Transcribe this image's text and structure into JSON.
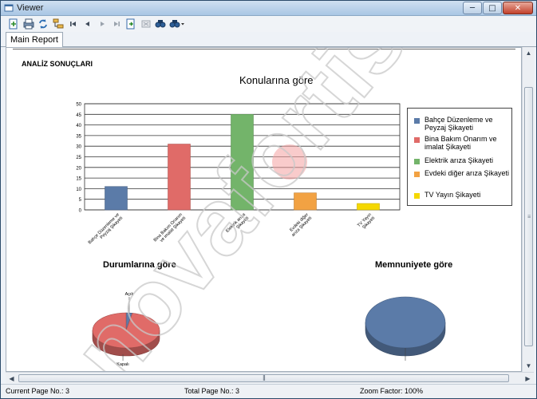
{
  "window": {
    "title": "Viewer",
    "minimize_glyph": "─",
    "maximize_glyph": "□",
    "close_glyph": "✕"
  },
  "toolbar": {
    "icons": [
      "export-icon",
      "print-icon",
      "refresh-icon",
      "tree-icon",
      "first-page-icon",
      "prev-page-icon",
      "next-page-icon",
      "last-page-icon",
      "goto-page-icon",
      "stop-icon",
      "find-icon",
      "zoom-icon"
    ]
  },
  "tabs": [
    {
      "label": "Main Report"
    }
  ],
  "report": {
    "heading": "ANALİZ SONUÇLARI",
    "bar_title": "Konularına göre",
    "pie1_title": "Durumlarına göre",
    "pie2_title": "Memnuniyete göre",
    "pie1_labels": [
      "Açık",
      "Kapalı"
    ],
    "legend": [
      {
        "label": "Bahçe Düzenleme ve Peyzaj Şikayeti",
        "color": "#5b7ba8"
      },
      {
        "label": "Bina Bakım Onarım ve imalat Şikayeti",
        "color": "#e06b68"
      },
      {
        "label": "Elektrik arıza Şikayeti",
        "color": "#73b46a"
      },
      {
        "label": "Evdeki diğer arıza Şikayeti",
        "color": "#f2a243"
      },
      {
        "label": "TV Yayın Şikayeti",
        "color": "#f5d800"
      }
    ]
  },
  "chart_data": [
    {
      "type": "bar",
      "title": "Konularına göre",
      "categories": [
        "Bahçe Düzenleme ve Peyzaj Şikayeti",
        "Bina Bakım Onarım ve imalat Şikayeti",
        "Elektrik arıza Şikayeti",
        "Evdeki diğer arıza Şikayeti",
        "TV Yayın Şikayeti"
      ],
      "values": [
        11,
        31,
        45,
        8,
        3
      ],
      "colors": [
        "#5b7ba8",
        "#e06b68",
        "#73b46a",
        "#f2a243",
        "#f5d800"
      ],
      "ylim": [
        0,
        50
      ],
      "yticks": [
        0,
        5,
        10,
        15,
        20,
        25,
        30,
        35,
        40,
        45,
        50
      ],
      "grid": true,
      "legend": "right"
    },
    {
      "type": "pie",
      "title": "Durumlarına göre",
      "categories": [
        "Açık",
        "Kapalı"
      ],
      "values": [
        3,
        97
      ],
      "colors": [
        "#5b7ba8",
        "#e06b68"
      ]
    },
    {
      "type": "pie",
      "title": "Memnuniyete göre",
      "categories": [
        ""
      ],
      "values": [
        100
      ],
      "colors": [
        "#5b7ba8"
      ]
    }
  ],
  "status": {
    "current_page": "Current Page No.: 3",
    "total_page": "Total Page No.: 3",
    "zoom": "Zoom Factor: 100%"
  },
  "watermark": {
    "text": "novafortis"
  }
}
